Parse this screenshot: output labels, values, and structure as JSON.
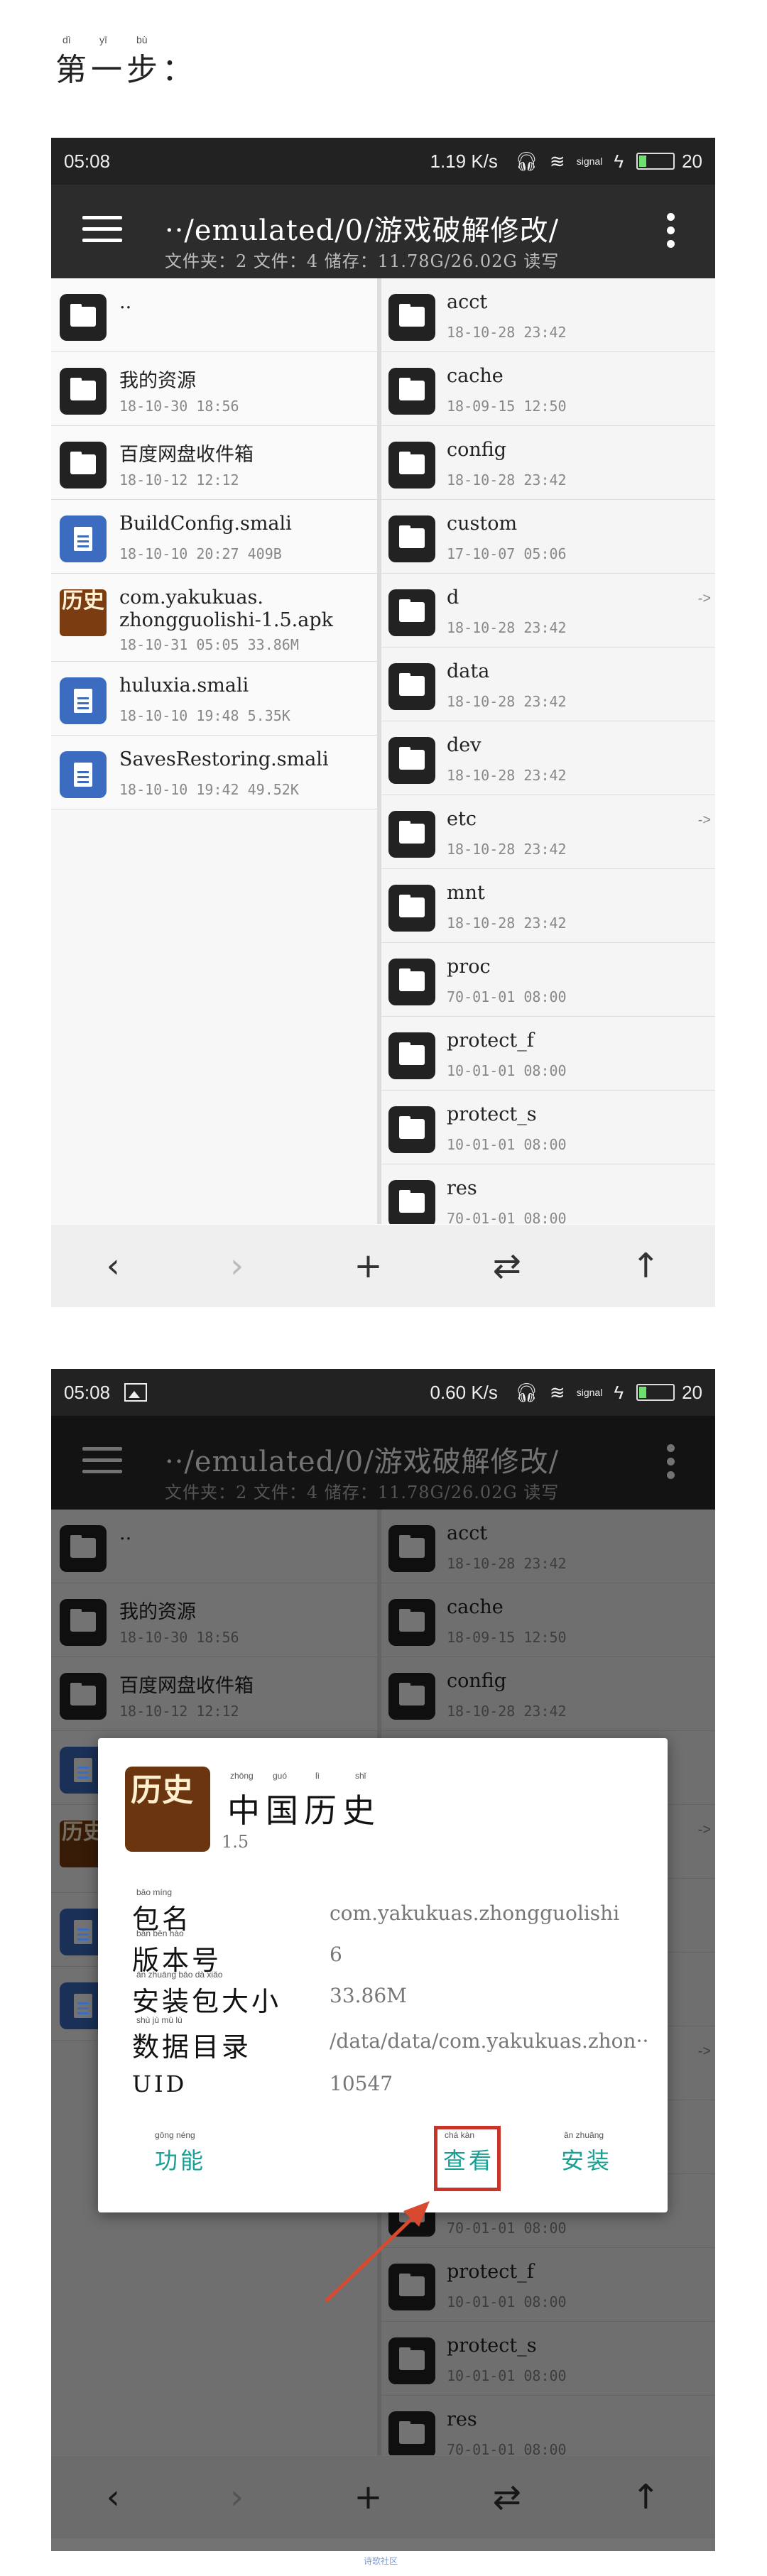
{
  "step_title": "第一步：",
  "step_ruby": [
    "dì",
    "yī",
    "bù"
  ],
  "statusbar1": {
    "time": "05:08",
    "speed": "1.19 K/s",
    "battery": "20",
    "signal": "signal",
    "battery_level": 0.2
  },
  "statusbar2": {
    "time": "05:08",
    "speed": "0.60 K/s",
    "battery": "20",
    "signal": "signal",
    "battery_level": 0.2
  },
  "appbar": {
    "path": "··/emulated/0/游戏破解修改/",
    "info": "文件夹：2  文件：4  储存：11.78G/26.02G  读写"
  },
  "left_files": [
    {
      "name": "..",
      "meta": "",
      "icon": "folder"
    },
    {
      "name": "我的资源",
      "meta": "18-10-30 18:56",
      "icon": "folder"
    },
    {
      "name": "百度网盘收件箱",
      "meta": "18-10-12 12:12",
      "icon": "folder"
    },
    {
      "name": "BuildConfig.smali",
      "meta": "18-10-10 20:27 409B",
      "icon": "doc"
    },
    {
      "name": "com.yakukuas.",
      "name2": "zhongguolishi-1.5.apk",
      "meta": "18-10-31 05:05 33.86M",
      "icon": "apk"
    },
    {
      "name": "huluxia.smali",
      "meta": "18-10-10 19:48 5.35K",
      "icon": "doc"
    },
    {
      "name": "SavesRestoring.smali",
      "meta": "18-10-10 19:42 49.52K",
      "icon": "doc"
    }
  ],
  "right_files": [
    {
      "name": "acct",
      "meta": "18-10-28 23:42"
    },
    {
      "name": "cache",
      "meta": "18-09-15 12:50"
    },
    {
      "name": "config",
      "meta": "18-10-28 23:42"
    },
    {
      "name": "custom",
      "meta": "17-10-07 05:06"
    },
    {
      "name": "d",
      "meta": "18-10-28 23:42",
      "arrow": "->"
    },
    {
      "name": "data",
      "meta": "18-10-28 23:42"
    },
    {
      "name": "dev",
      "meta": "18-10-28 23:42"
    },
    {
      "name": "etc",
      "meta": "18-10-28 23:42",
      "arrow": "->"
    },
    {
      "name": "mnt",
      "meta": "18-10-28 23:42"
    },
    {
      "name": "proc",
      "meta": "70-01-01 08:00"
    },
    {
      "name": "protect_f",
      "meta": "10-01-01 08:00"
    },
    {
      "name": "protect_s",
      "meta": "10-01-01 08:00"
    },
    {
      "name": "res",
      "meta": "70-01-01 08:00"
    }
  ],
  "bottombar": {
    "back": "‹",
    "forward": "›",
    "add": "+",
    "swap": "⇄",
    "up": "↑"
  },
  "dialog": {
    "app_name": "中国历史",
    "app_name_ruby": [
      "zhōng",
      "guó",
      "lì",
      "shǐ"
    ],
    "version": "1.5",
    "logo_text": "历史",
    "rows": [
      {
        "label": "包名",
        "ruby": "bāo míng",
        "value": "com.yakukuas.zhongguolishi"
      },
      {
        "label": "版本号",
        "ruby": "bǎn běn hào",
        "value": "6"
      },
      {
        "label": "安装包大小",
        "ruby": "ān zhuāng bāo dà xiǎo",
        "value": "33.86M"
      },
      {
        "label": "数据目录",
        "ruby": "shù jù mù lù",
        "value": "/data/data/com.yakukuas.zhon··"
      },
      {
        "label": "UID",
        "ruby": "",
        "value": "10547"
      }
    ],
    "actions": {
      "features": "功能",
      "features_ruby": "gōng néng",
      "view": "查看",
      "view_ruby": "chá kàn",
      "install": "安装",
      "install_ruby": "ān zhuāng"
    }
  },
  "footer_mark": "诗歌社区"
}
